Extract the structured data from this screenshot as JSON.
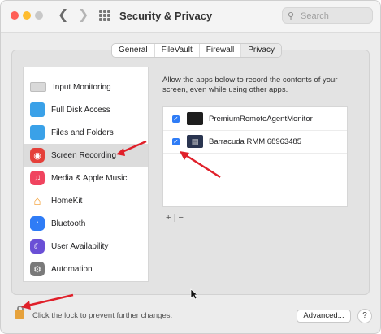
{
  "window": {
    "title": "Security & Privacy"
  },
  "search": {
    "placeholder": "Search"
  },
  "tabs": [
    {
      "label": "General",
      "active": false
    },
    {
      "label": "FileVault",
      "active": false
    },
    {
      "label": "Firewall",
      "active": false
    },
    {
      "label": "Privacy",
      "active": true
    }
  ],
  "sidebar": {
    "items": [
      {
        "label": "Input Monitoring",
        "icon": "keyboard-icon"
      },
      {
        "label": "Full Disk Access",
        "icon": "folder-icon"
      },
      {
        "label": "Files and Folders",
        "icon": "folder-icon"
      },
      {
        "label": "Screen Recording",
        "icon": "screen-recording-icon",
        "selected": true
      },
      {
        "label": "Media & Apple Music",
        "icon": "music-icon"
      },
      {
        "label": "HomeKit",
        "icon": "home-icon"
      },
      {
        "label": "Bluetooth",
        "icon": "bluetooth-icon"
      },
      {
        "label": "User Availability",
        "icon": "moon-icon"
      },
      {
        "label": "Automation",
        "icon": "gear-icon"
      }
    ]
  },
  "main": {
    "description": "Allow the apps below to record the contents of your screen, even while using other apps.",
    "apps": [
      {
        "name": "PremiumRemoteAgentMonitor",
        "checked": true
      },
      {
        "name": "Barracuda RMM 68963485",
        "checked": true
      }
    ],
    "add_label": "+",
    "remove_label": "−"
  },
  "footer": {
    "lock_text": "Click the lock to prevent further changes.",
    "advanced_label": "Advanced...",
    "help_label": "?"
  },
  "colors": {
    "accent": "#2f7cf6",
    "annotation_arrow": "#e0202a"
  }
}
